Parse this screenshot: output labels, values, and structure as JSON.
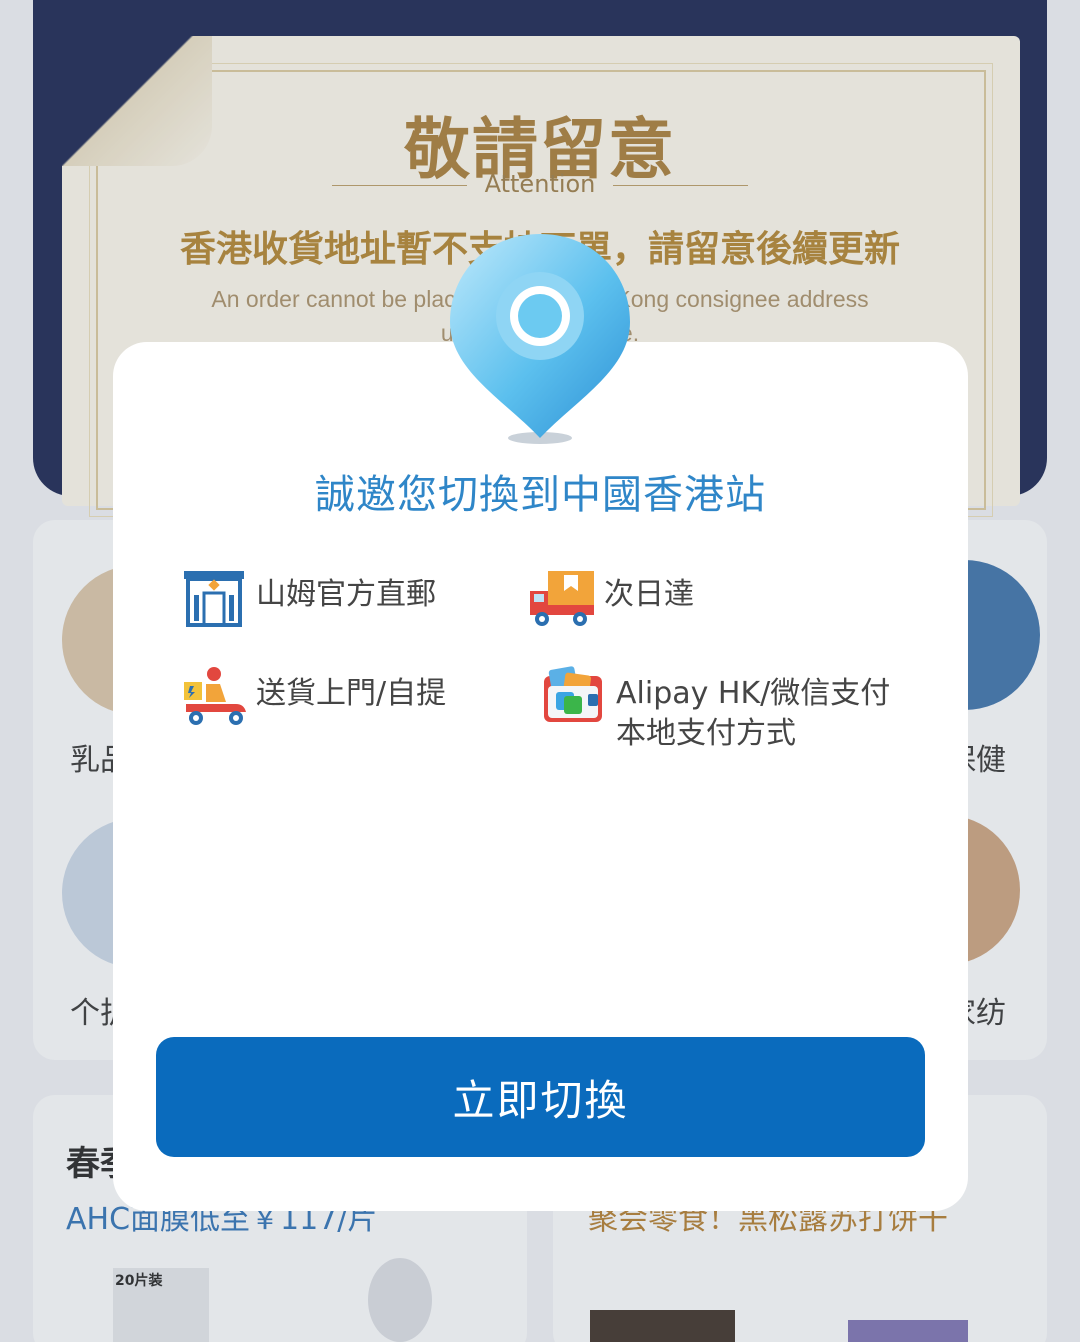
{
  "notice": {
    "title": "敬請留意",
    "subtitle": "Attention",
    "headline": "香港收貨地址暫不支持下單，請留意後續更新",
    "english_line1": "An order cannot be placed with a Hong Kong consignee address",
    "english_line2": "until further update."
  },
  "background": {
    "categories": [
      {
        "label": "乳品"
      },
      {
        "label": "保健"
      },
      {
        "label": "个护"
      },
      {
        "label": "家纺"
      }
    ],
    "promo_left": {
      "title": "春季",
      "subtitle": "AHC面膜低至￥117/片"
    },
    "promo_right": {
      "subtitle": "聚会零食！黑松露苏打饼干"
    },
    "thumb_badge": "20片装"
  },
  "modal": {
    "title": "誠邀您切換到中國香港站",
    "features": [
      {
        "icon": "storefront-icon",
        "label": "山姆官方直郵"
      },
      {
        "icon": "delivery-truck-icon",
        "label": "次日達"
      },
      {
        "icon": "courier-scooter-icon",
        "label": "送貨上門/自提"
      },
      {
        "icon": "wallet-payment-icon",
        "label_line1": "Alipay HK/微信支付",
        "label_line2": "本地支付方式"
      }
    ],
    "button_label": "立即切換"
  },
  "colors": {
    "accent": "#0a6bbd",
    "title_blue": "#2f86c8",
    "banner_navy": "#16224f",
    "notice_gold": "#a67a35"
  }
}
